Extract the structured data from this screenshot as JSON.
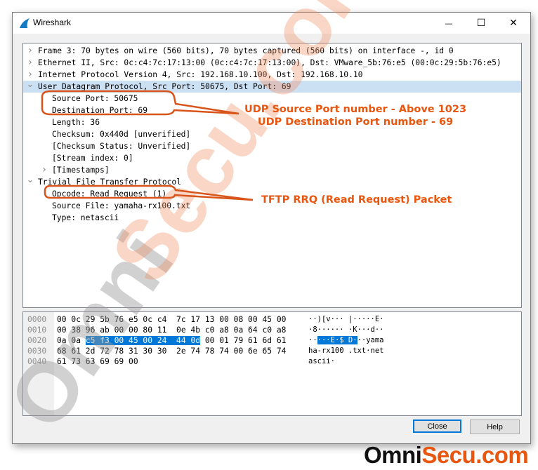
{
  "window": {
    "title": "Wireshark",
    "controls": {
      "minimize": "—",
      "maximize": "☐",
      "close": "✕"
    }
  },
  "packet_tree": [
    {
      "text": "Frame 3: 70 bytes on wire (560 bits), 70 bytes captured (560 bits) on interface -, id 0",
      "level": 0,
      "expander": "collapsed"
    },
    {
      "text": "Ethernet II, Src: 0c:c4:7c:17:13:00 (0c:c4:7c:17:13:00), Dst: VMware_5b:76:e5 (00:0c:29:5b:76:e5)",
      "level": 0,
      "expander": "collapsed"
    },
    {
      "text": "Internet Protocol Version 4, Src: 192.168.10.100, Dst: 192.168.10.10",
      "level": 0,
      "expander": "collapsed"
    },
    {
      "text": "User Datagram Protocol, Src Port: 50675, Dst Port: 69",
      "level": 0,
      "expander": "expanded",
      "selected": true
    },
    {
      "text": "Source Port: 50675",
      "level": 1
    },
    {
      "text": "Destination Port: 69",
      "level": 1
    },
    {
      "text": "Length: 36",
      "level": 1
    },
    {
      "text": "Checksum: 0x440d [unverified]",
      "level": 1
    },
    {
      "text": "[Checksum Status: Unverified]",
      "level": 1
    },
    {
      "text": "[Stream index: 0]",
      "level": 1
    },
    {
      "text": "[Timestamps]",
      "level": 1,
      "expander": "collapsed"
    },
    {
      "text": "Trivial File Transfer Protocol",
      "level": 0,
      "expander": "expanded"
    },
    {
      "text": "Opcode: Read Request (1)",
      "level": 1
    },
    {
      "text": "Source File: yamaha-rx100.txt",
      "level": 1
    },
    {
      "text": "Type: netascii",
      "level": 1
    }
  ],
  "hex_dump": [
    {
      "offset": "0000",
      "pre": "00 0c 29 5b 76 e5 0c c4  7c 17 13 00 08 00 45 00",
      "hl": "",
      "post": "",
      "ascii_pre": "··)[v··· |·····E·",
      "ascii_hl": "",
      "ascii_post": ""
    },
    {
      "offset": "0010",
      "pre": "00 38 96 ab 00 00 80 11  0e 4b c0 a8 0a 64 c0 a8",
      "hl": "",
      "post": "",
      "ascii_pre": "·8······ ·K···d··",
      "ascii_hl": "",
      "ascii_post": ""
    },
    {
      "offset": "0020",
      "pre": "0a 0a ",
      "hl": "c5 f3 00 45 00 24  44 0d",
      "post": " 00 01 79 61 6d 61",
      "ascii_pre": "··",
      "ascii_hl": "···E·$ D·",
      "ascii_post": "··yama"
    },
    {
      "offset": "0030",
      "pre": "68 61 2d 72 78 31 30 30  2e 74 78 74 00 6e 65 74",
      "hl": "",
      "post": "",
      "ascii_pre": "ha-rx100 .txt·net",
      "ascii_hl": "",
      "ascii_post": ""
    },
    {
      "offset": "0040",
      "pre": "61 73 63 69 69 00",
      "hl": "",
      "post": "",
      "ascii_pre": "ascii·",
      "ascii_hl": "",
      "ascii_post": ""
    }
  ],
  "buttons": {
    "close": "Close",
    "help": "Help"
  },
  "annotations": {
    "udp_line1": "UDP Source Port number - Above 1023",
    "udp_line2": "UDP Destination Port number - 69",
    "tftp": "TFTP RRQ (Read Request) Packet"
  },
  "watermark": {
    "part1": "Omni",
    "part2": "Secu.com"
  },
  "brand": {
    "part1": "Omni",
    "part2": "Secu.com"
  },
  "colors": {
    "accent": "#e8560f",
    "selection": "#cce0f4",
    "hex_highlight": "#0078d7"
  }
}
